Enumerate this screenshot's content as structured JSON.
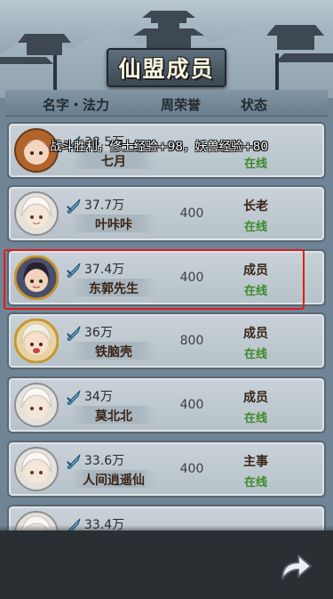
{
  "header": {
    "title": "仙盟成员",
    "col_name": "名字・法力",
    "col_honor": "周荣誉",
    "col_status": "状态"
  },
  "toast": {
    "text": "战斗胜利，修士经验+98，妖兽经验+80"
  },
  "members": [
    {
      "power": "38.5万",
      "name": "七月",
      "honor": "",
      "role": "",
      "status": "在线",
      "avatar": "female-brown-hair-icon"
    },
    {
      "power": "37.7万",
      "name": "叶咔咔",
      "honor": "400",
      "role": "长老",
      "status": "在线",
      "avatar": "white-hair-icon"
    },
    {
      "power": "37.4万",
      "name": "东郭先生",
      "honor": "400",
      "role": "成员",
      "status": "在线",
      "avatar": "dark-hair-dragon-frame-icon"
    },
    {
      "power": "36万",
      "name": "铁脑壳",
      "honor": "800",
      "role": "成员",
      "status": "在线",
      "avatar": "blonde-dragon-frame-icon"
    },
    {
      "power": "34万",
      "name": "莫北北",
      "honor": "400",
      "role": "成员",
      "status": "在线",
      "avatar": "white-hair-icon"
    },
    {
      "power": "33.6万",
      "name": "人间逍遥仙",
      "honor": "400",
      "role": "主事",
      "status": "在线",
      "avatar": "white-hair-icon"
    },
    {
      "power": "33.4万",
      "name": "",
      "honor": "",
      "role": "",
      "status": "",
      "avatar": "white-hair-icon"
    }
  ],
  "colors": {
    "online": "#3c8a2a",
    "highlight": "#e01b1b"
  }
}
